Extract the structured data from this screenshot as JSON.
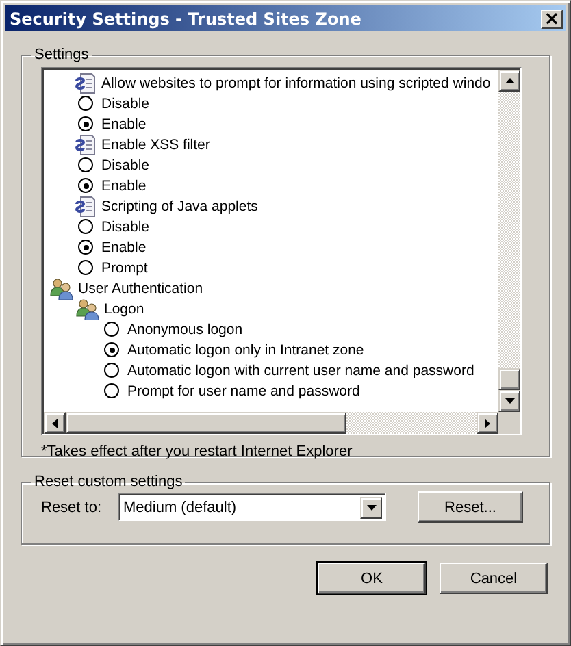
{
  "window": {
    "title": "Security Settings - Trusted Sites Zone",
    "close": "×"
  },
  "settings": {
    "legend": "Settings",
    "items": [
      {
        "kind": "setting",
        "label": "Allow websites to prompt for information using scripted windo",
        "children": [
          {
            "kind": "radio",
            "label": "Disable",
            "selected": false
          },
          {
            "kind": "radio",
            "label": "Enable",
            "selected": true
          }
        ]
      },
      {
        "kind": "setting",
        "label": "Enable XSS filter",
        "children": [
          {
            "kind": "radio",
            "label": "Disable",
            "selected": false
          },
          {
            "kind": "radio",
            "label": "Enable",
            "selected": true
          }
        ]
      },
      {
        "kind": "setting",
        "label": "Scripting of Java applets",
        "children": [
          {
            "kind": "radio",
            "label": "Disable",
            "selected": false
          },
          {
            "kind": "radio",
            "label": "Enable",
            "selected": true
          },
          {
            "kind": "radio",
            "label": "Prompt",
            "selected": false
          }
        ]
      },
      {
        "kind": "group",
        "label": "User Authentication",
        "children": [
          {
            "kind": "group",
            "label": "Logon",
            "children": [
              {
                "kind": "radio",
                "label": "Anonymous logon",
                "selected": false
              },
              {
                "kind": "radio",
                "label": "Automatic logon only in Intranet zone",
                "selected": true
              },
              {
                "kind": "radio",
                "label": "Automatic logon with current user name and password",
                "selected": false
              },
              {
                "kind": "radio",
                "label": "Prompt for user name and password",
                "selected": false
              }
            ]
          }
        ]
      }
    ],
    "note": "*Takes effect after you restart Internet Explorer"
  },
  "reset": {
    "legend": "Reset custom settings",
    "label": "Reset to:",
    "value": "Medium (default)",
    "button": "Reset..."
  },
  "buttons": [
    "OK",
    "Cancel"
  ]
}
